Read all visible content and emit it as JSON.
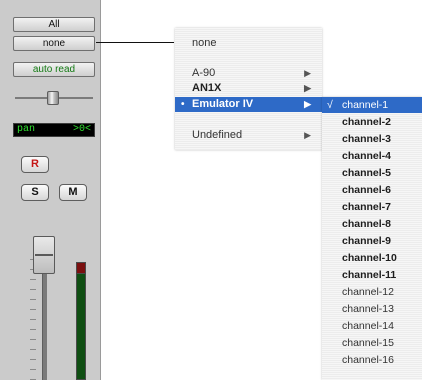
{
  "strip": {
    "all_label": "All",
    "none_label": "none",
    "automation_label": "auto read",
    "pan_label": "pan",
    "pan_value": ">0<",
    "record_label": "R",
    "solo_label": "S",
    "mute_label": "M"
  },
  "menu": {
    "none_label": "none",
    "items": [
      {
        "label": "A-90",
        "has_submenu": true
      },
      {
        "label": "AN1X",
        "has_submenu": true
      },
      {
        "label": "Emulator IV",
        "has_submenu": true,
        "selected": true,
        "marker": "•"
      },
      {
        "label": "Undefined",
        "has_submenu": true
      }
    ],
    "arrow_glyph": "▶"
  },
  "submenu": {
    "check_glyph": "√",
    "items": [
      {
        "label": "channel-1",
        "checked": true
      },
      {
        "label": "channel-2"
      },
      {
        "label": "channel-3"
      },
      {
        "label": "channel-4"
      },
      {
        "label": "channel-5"
      },
      {
        "label": "channel-6"
      },
      {
        "label": "channel-7"
      },
      {
        "label": "channel-8"
      },
      {
        "label": "channel-9"
      },
      {
        "label": "channel-10"
      },
      {
        "label": "channel-11"
      },
      {
        "label": "channel-12"
      },
      {
        "label": "channel-13"
      },
      {
        "label": "channel-14"
      },
      {
        "label": "channel-15"
      },
      {
        "label": "channel-16"
      }
    ]
  },
  "colors": {
    "selection": "#2e6ac7",
    "record": "#c41616",
    "automation": "#137a13",
    "pan_text": "#31e331"
  }
}
